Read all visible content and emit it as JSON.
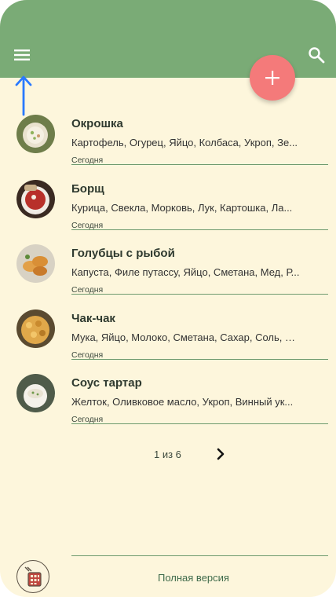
{
  "appbar": {
    "menu_icon": "hamburger-menu-icon",
    "search_icon": "search-icon",
    "add_icon": "plus-icon"
  },
  "colors": {
    "appbar": "#7aab76",
    "background": "#fdf6dc",
    "fab": "#f47a7a",
    "annotation_arrow": "#2979ff",
    "divider": "#6e9a6e"
  },
  "recipes": [
    {
      "title": "Окрошка",
      "ingredients": "Картофель, Огурец, Яйцо, Колбаса, Укроп, Зе...",
      "date": "Сегодня"
    },
    {
      "title": "Борщ",
      "ingredients": "Курица, Свекла, Морковь, Лук, Картошка, Ла...",
      "date": "Сегодня"
    },
    {
      "title": "Голубцы с рыбой",
      "ingredients": "Капуста, Филе путассу, Яйцо, Сметана, Мед, Р...",
      "date": "Сегодня"
    },
    {
      "title": "Чак-чак",
      "ingredients": "Мука, Яйцо, Молоко, Сметана, Сахар, Соль, М...",
      "date": "Сегодня"
    },
    {
      "title": "Соус тартар",
      "ingredients": "Желток, Оливковое масло, Укроп, Винный ук...",
      "date": "Сегодня"
    }
  ],
  "pager": {
    "label": "1 из 6",
    "next_icon": "chevron-right-icon"
  },
  "footer": {
    "full_version_label": "Полная версия",
    "calculator_icon": "calculator-icon"
  }
}
